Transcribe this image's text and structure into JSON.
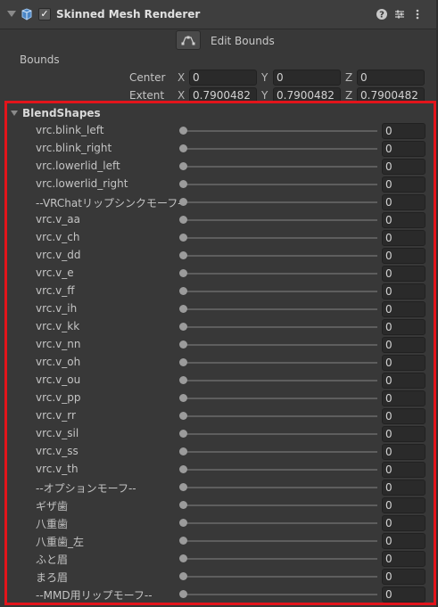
{
  "component": {
    "title": "Skinned Mesh Renderer",
    "enabled_mark": "✓",
    "icons": [
      "fold-arrow-icon",
      "mesh-renderer-icon",
      "help-icon",
      "preset-icon",
      "more-menu-icon"
    ]
  },
  "edit_bounds": {
    "label": "Edit Bounds",
    "icon": "edit-bounds-icon"
  },
  "bounds": {
    "label": "Bounds",
    "center": {
      "label": "Center",
      "x_axis": "X",
      "x": "0",
      "y_axis": "Y",
      "y": "0",
      "z_axis": "Z",
      "z": "0"
    },
    "extent": {
      "label": "Extent",
      "x_axis": "X",
      "x": "0.7900482",
      "y_axis": "Y",
      "y": "0.7900482",
      "z_axis": "Z",
      "z": "0.7900482"
    }
  },
  "blendshapes": {
    "title": "BlendShapes",
    "highlight_color": "#e3141b",
    "rows": [
      {
        "name": "vrc.blink_left",
        "value": "0"
      },
      {
        "name": "vrc.blink_right",
        "value": "0"
      },
      {
        "name": "vrc.lowerlid_left",
        "value": "0"
      },
      {
        "name": "vrc.lowerlid_right",
        "value": "0"
      },
      {
        "name": "--VRChatリップシンクモーフ--",
        "value": "0"
      },
      {
        "name": "vrc.v_aa",
        "value": "0"
      },
      {
        "name": "vrc.v_ch",
        "value": "0"
      },
      {
        "name": "vrc.v_dd",
        "value": "0"
      },
      {
        "name": "vrc.v_e",
        "value": "0"
      },
      {
        "name": "vrc.v_ff",
        "value": "0"
      },
      {
        "name": "vrc.v_ih",
        "value": "0"
      },
      {
        "name": "vrc.v_kk",
        "value": "0"
      },
      {
        "name": "vrc.v_nn",
        "value": "0"
      },
      {
        "name": "vrc.v_oh",
        "value": "0"
      },
      {
        "name": "vrc.v_ou",
        "value": "0"
      },
      {
        "name": "vrc.v_pp",
        "value": "0"
      },
      {
        "name": "vrc.v_rr",
        "value": "0"
      },
      {
        "name": "vrc.v_sil",
        "value": "0"
      },
      {
        "name": "vrc.v_ss",
        "value": "0"
      },
      {
        "name": "vrc.v_th",
        "value": "0"
      },
      {
        "name": "--オプションモーフ--",
        "value": "0"
      },
      {
        "name": "ギザ歯",
        "value": "0"
      },
      {
        "name": "八重歯",
        "value": "0"
      },
      {
        "name": "八重歯_左",
        "value": "0"
      },
      {
        "name": "ふと眉",
        "value": "0"
      },
      {
        "name": "まろ眉",
        "value": "0"
      },
      {
        "name": "--MMD用リップモーフ--",
        "value": "0"
      }
    ]
  }
}
